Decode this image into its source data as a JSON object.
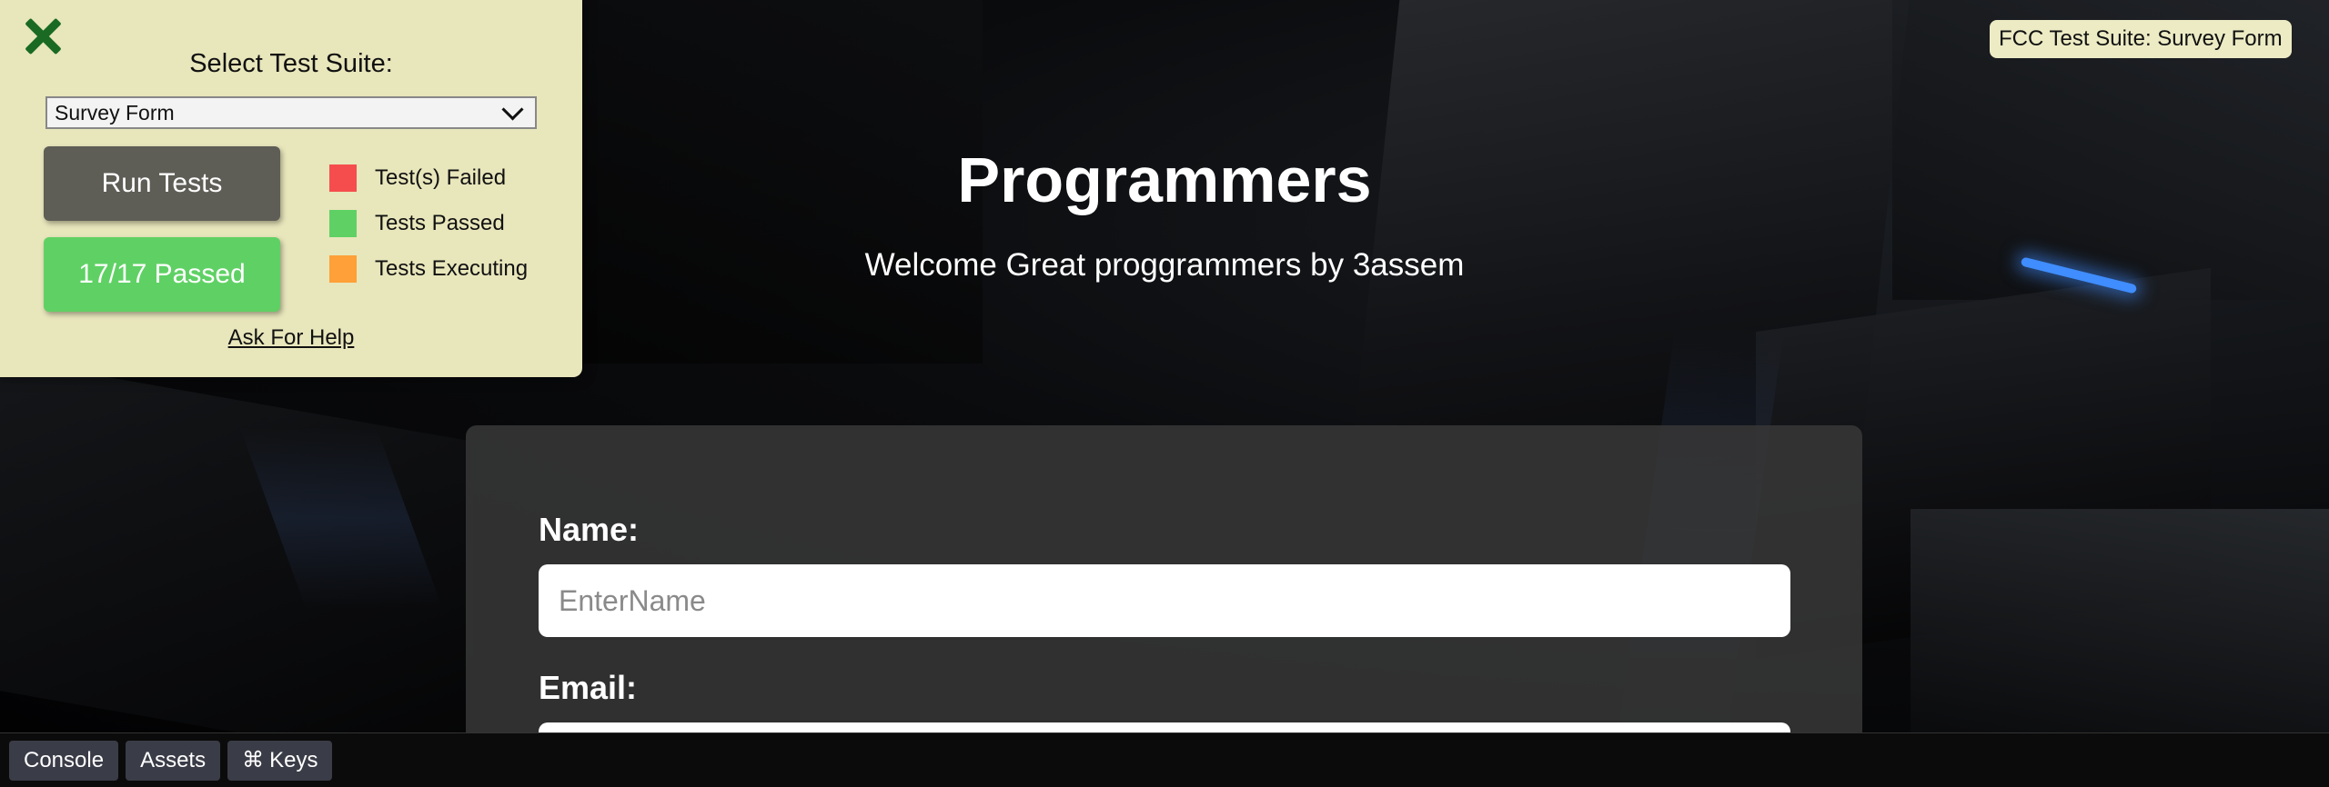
{
  "fcc_panel": {
    "suite_label": "Select Test Suite:",
    "suite_selected": "Survey Form",
    "run_button": "Run Tests",
    "result_button": "17/17 Passed",
    "legend": [
      {
        "label": "Test(s) Failed",
        "color": "#f54d4d"
      },
      {
        "label": "Tests Passed",
        "color": "#5fd164"
      },
      {
        "label": "Tests Executing",
        "color": "#ffa038"
      }
    ],
    "help_link": "Ask For Help"
  },
  "suite_badge": "FCC Test Suite: Survey Form",
  "header": {
    "title": "Programmers",
    "subtitle": "Welcome Great proggrammers by 3assem"
  },
  "form": {
    "name_label": "Name:",
    "name_placeholder": "EnterName",
    "email_label": "Email:"
  },
  "dev_toolbar": {
    "console": "Console",
    "assets": "Assets",
    "keys_symbol": "⌘",
    "keys": "Keys"
  },
  "colors": {
    "panel_bg": "#e8e6bb",
    "close_icon": "#1a6a24",
    "run_button_bg": "#5e5d56",
    "passed_button_bg": "#5fd164",
    "form_card_bg": "#373737",
    "accent_glow": "#3f8dff"
  }
}
